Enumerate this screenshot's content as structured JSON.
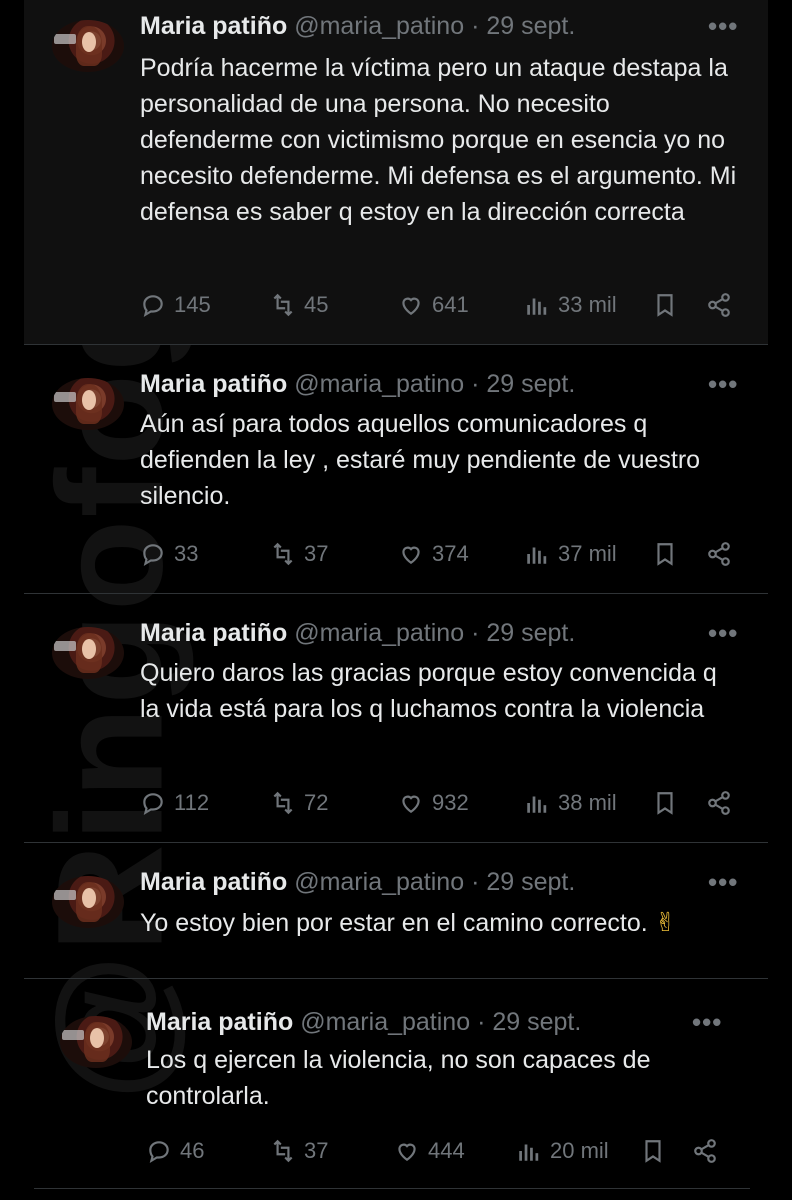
{
  "watermark": "@Ringofogo3",
  "tweets": [
    {
      "name": "Maria patiño",
      "handle": "@maria_patino",
      "separator": "·",
      "date": "29 sept.",
      "more": "•••",
      "text": "Podría hacerme la víctima pero un ataque destapa la personalidad de una persona. No necesito defenderme con victimismo porque en esencia yo no necesito defenderme. Mi defensa es el argumento. Mi defensa es saber q estoy en la dirección correcta",
      "replies": "145",
      "retweets": "45",
      "likes": "641",
      "views": "33 mil"
    },
    {
      "name": "Maria patiño",
      "handle": "@maria_patino",
      "separator": "·",
      "date": "29 sept.",
      "more": "•••",
      "text": "Aún así para todos aquellos comunicadores q defienden la ley , estaré muy pendiente de vuestro silencio.",
      "replies": "33",
      "retweets": "37",
      "likes": "374",
      "views": "37 mil"
    },
    {
      "name": "Maria patiño",
      "handle": "@maria_patino",
      "separator": "·",
      "date": "29 sept.",
      "more": "•••",
      "text": "Quiero daros las gracias porque estoy convencida q la vida está para los q luchamos contra la violencia",
      "replies": "112",
      "retweets": "72",
      "likes": "932",
      "views": "38 mil"
    },
    {
      "name": "Maria patiño",
      "handle": "@maria_patino",
      "separator": "·",
      "date": "29 sept.",
      "more": "•••",
      "text": "Yo estoy bien por estar en el camino correcto.",
      "emoji": "✌"
    },
    {
      "name": "Maria patiño",
      "handle": "@maria_patino",
      "separator": "·",
      "date": "29 sept.",
      "more": "•••",
      "text": "Los q ejercen la violencia, no son capaces de controlarla.",
      "replies": "46",
      "retweets": "37",
      "likes": "444",
      "views": "20 mil"
    }
  ],
  "icons": {
    "reply": "reply-icon",
    "retweet": "retweet-icon",
    "like": "like-icon",
    "views": "views-icon",
    "bookmark": "bookmark-icon",
    "share": "share-icon",
    "more": "more-icon"
  },
  "colors": {
    "background": "#000000",
    "text": "#e7e9ea",
    "muted": "#71767b",
    "divider": "#2f3336"
  }
}
